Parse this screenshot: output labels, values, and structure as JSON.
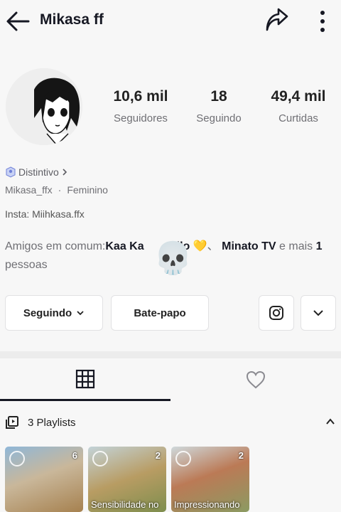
{
  "header": {
    "title": "Mikasa ff",
    "back_icon": "arrow-left-icon",
    "share_icon": "share-arrow-icon",
    "more_icon": "more-vertical-icon"
  },
  "profile": {
    "avatar_icon": "anime-avatar",
    "stats": [
      {
        "value": "10,6 mil",
        "label": "Seguidores"
      },
      {
        "value": "18",
        "label": "Seguindo"
      },
      {
        "value": "49,4 mil",
        "label": "Curtidas"
      }
    ],
    "badge": "Distintivo",
    "username": "Mikasa_ffx",
    "gender": "Feminino",
    "bio": "Insta: Miihkasa.ffx",
    "friends": {
      "prefix": "Amigos em comum:",
      "name1": "Kaa Ka",
      "name1_end": "llo",
      "heart": "💛",
      "separator": "、",
      "name2": "Minato TV",
      "middle": " e mais ",
      "count": "1",
      "suffix": " pessoas"
    },
    "overlay_emoji": "💀"
  },
  "actions": {
    "following_label": "Seguindo",
    "chat_label": "Bate-papo",
    "instagram_icon": "instagram-icon",
    "expand_icon": "chevron-down-icon"
  },
  "tabs": [
    {
      "icon": "grid-icon",
      "active": true
    },
    {
      "icon": "heart-icon",
      "active": false
    }
  ],
  "playlists": {
    "header": "3 Playlists",
    "items": [
      {
        "count": "6",
        "caption": ""
      },
      {
        "count": "2",
        "caption": "Sensibilidade no"
      },
      {
        "count": "2",
        "caption": "Impressionando"
      }
    ]
  },
  "colors": {
    "background": "#f7f7f7",
    "text": "#161823",
    "secondary": "#6f6f74",
    "border": "#e1e1e3"
  }
}
